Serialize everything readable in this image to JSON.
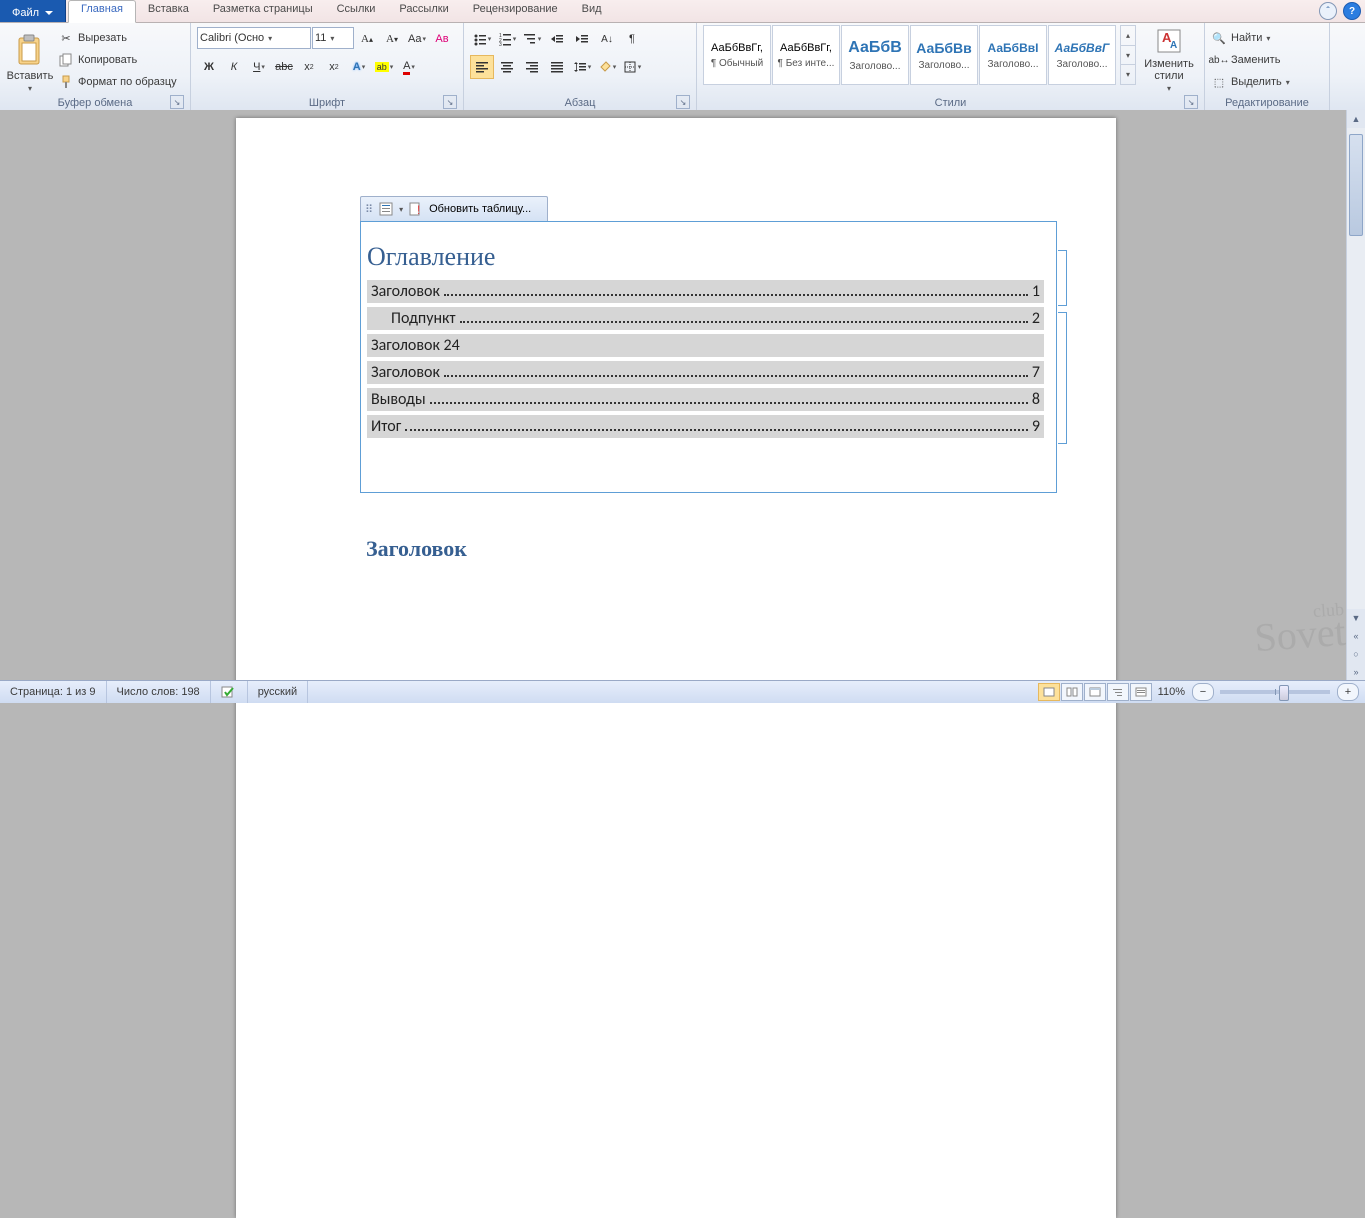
{
  "tabs": {
    "file": "Файл",
    "home": "Главная",
    "insert": "Вставка",
    "layout": "Разметка страницы",
    "refs": "Ссылки",
    "mail": "Рассылки",
    "review": "Рецензирование",
    "view": "Вид"
  },
  "clipboard": {
    "paste": "Вставить",
    "cut": "Вырезать",
    "copy": "Копировать",
    "format": "Формат по образцу",
    "group": "Буфер обмена"
  },
  "font": {
    "name": "Calibri (Осно",
    "size": "11",
    "group": "Шрифт"
  },
  "para": {
    "group": "Абзац"
  },
  "styles": {
    "group": "Стили",
    "change": "Изменить стили",
    "items": [
      {
        "sample": "АаБбВвГг,",
        "name": "¶ Обычный",
        "color": "#000",
        "fs": "11px"
      },
      {
        "sample": "АаБбВвГг,",
        "name": "¶ Без инте...",
        "color": "#000",
        "fs": "11px"
      },
      {
        "sample": "АаБбВ",
        "name": "Заголово...",
        "color": "#2e74b5",
        "fs": "16px",
        "bold": true
      },
      {
        "sample": "АаБбВв",
        "name": "Заголово...",
        "color": "#2e74b5",
        "fs": "14px",
        "bold": true
      },
      {
        "sample": "АаБбВвI",
        "name": "Заголово...",
        "color": "#2e74b5",
        "fs": "12px",
        "bold": true
      },
      {
        "sample": "АаБбВвГ",
        "name": "Заголово...",
        "color": "#2e74b5",
        "fs": "12px",
        "italic": true,
        "bold": true
      }
    ]
  },
  "editing": {
    "find": "Найти",
    "replace": "Заменить",
    "select": "Выделить",
    "group": "Редактирование"
  },
  "toc": {
    "update": "Обновить таблицу...",
    "title": "Оглавление",
    "entries": [
      {
        "text": "Заголовок",
        "page": "1",
        "indent": false,
        "dots": true
      },
      {
        "text": "Подпункт",
        "page": "2",
        "indent": true,
        "dots": true
      },
      {
        "text": "Заголовок 2",
        "page": "4",
        "indent": false,
        "dots": false
      },
      {
        "text": "Заголовок",
        "page": "7",
        "indent": false,
        "dots": true
      },
      {
        "text": "Выводы",
        "page": "8",
        "indent": false,
        "dots": true
      },
      {
        "text": "Итог",
        "page": "9",
        "indent": false,
        "dots": true
      }
    ]
  },
  "body": {
    "heading": "Заголовок"
  },
  "status": {
    "page": "Страница: 1 из 9",
    "words": "Число слов: 198",
    "lang": "русский",
    "zoom": "110%"
  },
  "watermark": {
    "top": "club",
    "bottom": "Sovet"
  }
}
